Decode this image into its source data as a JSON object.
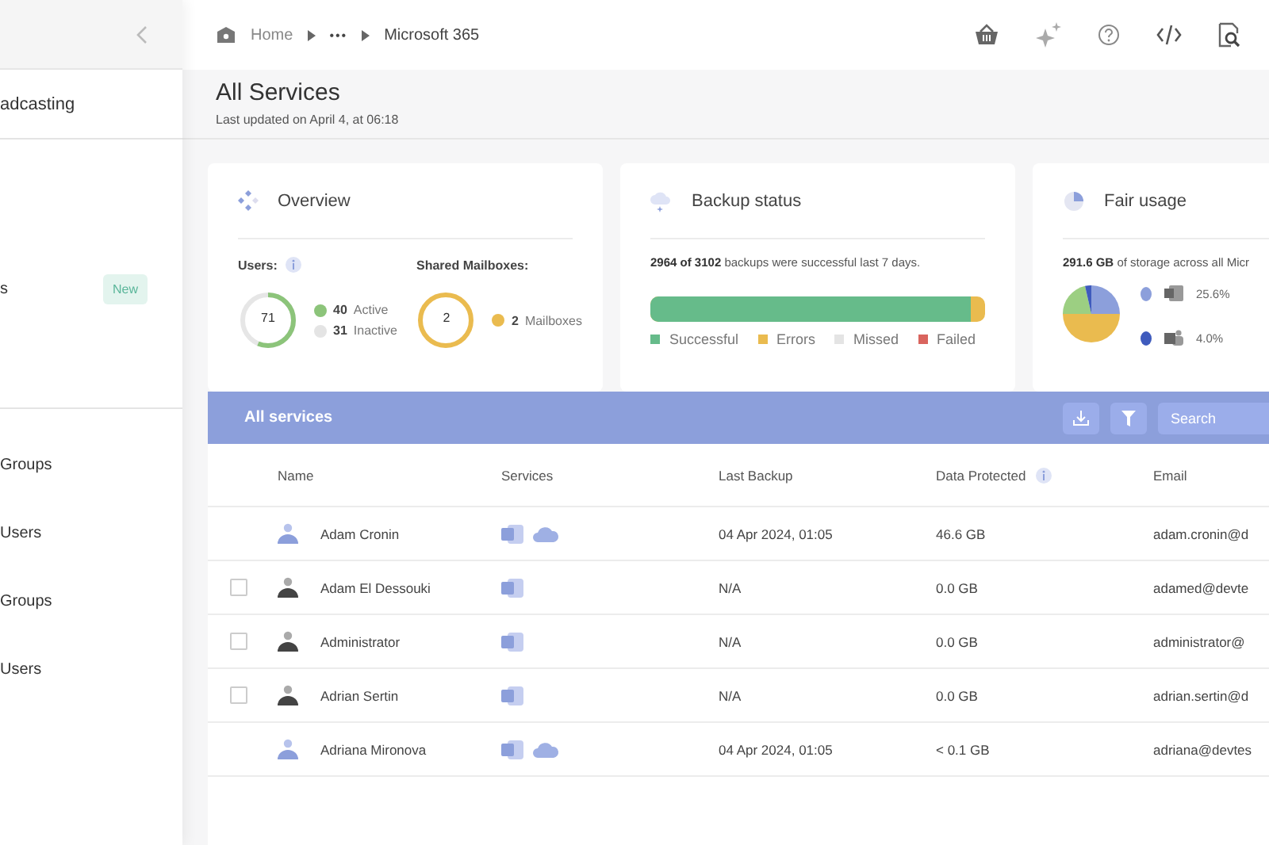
{
  "sidebar": {
    "items": [
      {
        "label": "adcasting"
      },
      {
        "label": "s",
        "badge": "New"
      },
      {
        "label": "Groups"
      },
      {
        "label": "Users"
      },
      {
        "label": "Groups"
      },
      {
        "label": "Users"
      }
    ]
  },
  "breadcrumb": {
    "home": "Home",
    "ellipsis": "•••",
    "current": "Microsoft 365"
  },
  "header": {
    "title": "All Services",
    "subtitle": "Last updated on April 4, at 06:18"
  },
  "overview": {
    "title": "Overview",
    "users_label": "Users:",
    "users_total": "71",
    "active_count": "40",
    "active_label": "Active",
    "inactive_count": "31",
    "inactive_label": "Inactive",
    "shared_label": "Shared Mailboxes:",
    "shared_total": "2",
    "shared_count": "2",
    "shared_text": "Mailboxes"
  },
  "backup": {
    "title": "Backup status",
    "summary": "**2964 of 3102** backups were successful last 7 days.",
    "level": 0.955,
    "legend": [
      {
        "label": "Successful",
        "color": "#66bb8a"
      },
      {
        "label": "Errors",
        "color": "#eabb4f"
      },
      {
        "label": "Missed",
        "color": "#e4e4e4"
      },
      {
        "label": "Failed",
        "color": "#d9645e"
      }
    ]
  },
  "fair_usage": {
    "title": "Fair usage",
    "summary": "**291.6 GB** of storage across all Micr",
    "legend": [
      {
        "color": "#8c9fdb",
        "kind": "mail",
        "value": "25.6%"
      },
      {
        "color": "#3f5bbd",
        "kind": "chat",
        "value": "4.0%"
      }
    ]
  },
  "table": {
    "title": "All services",
    "search": {
      "placeholder": "Search"
    },
    "columns": [
      "Name",
      "Services",
      "Last Backup",
      "Data Protected",
      "Email"
    ],
    "rows": [
      {
        "active": true,
        "name": "Adam Cronin",
        "services": [
          {
            "kind": "mail"
          },
          {
            "kind": "cloud"
          }
        ],
        "last_backup": "04 Apr 2024, 01:05",
        "data": "46.6 GB",
        "email": "adam.cronin@d"
      },
      {
        "active": false,
        "checked": false,
        "name": "Adam El Dessouki",
        "services": [
          {
            "kind": "mail"
          }
        ],
        "last_backup": "N/A",
        "data": "0.0 GB",
        "email": "adamed@devte"
      },
      {
        "active": false,
        "checked": false,
        "name": "Administrator",
        "services": [
          {
            "kind": "mail"
          }
        ],
        "last_backup": "N/A",
        "data": "0.0 GB",
        "email": "administrator@"
      },
      {
        "active": false,
        "checked": false,
        "name": "Adrian Sertin",
        "services": [
          {
            "kind": "mail"
          }
        ],
        "last_backup": "N/A",
        "data": "0.0 GB",
        "email": "adrian.sertin@d"
      },
      {
        "active": true,
        "name": "Adriana Mironova",
        "services": [
          {
            "kind": "mail"
          },
          {
            "kind": "cloud"
          }
        ],
        "last_backup": "04 Apr 2024, 01:05",
        "data": "< 0.1 GB",
        "email": "adriana@devtes"
      }
    ]
  }
}
